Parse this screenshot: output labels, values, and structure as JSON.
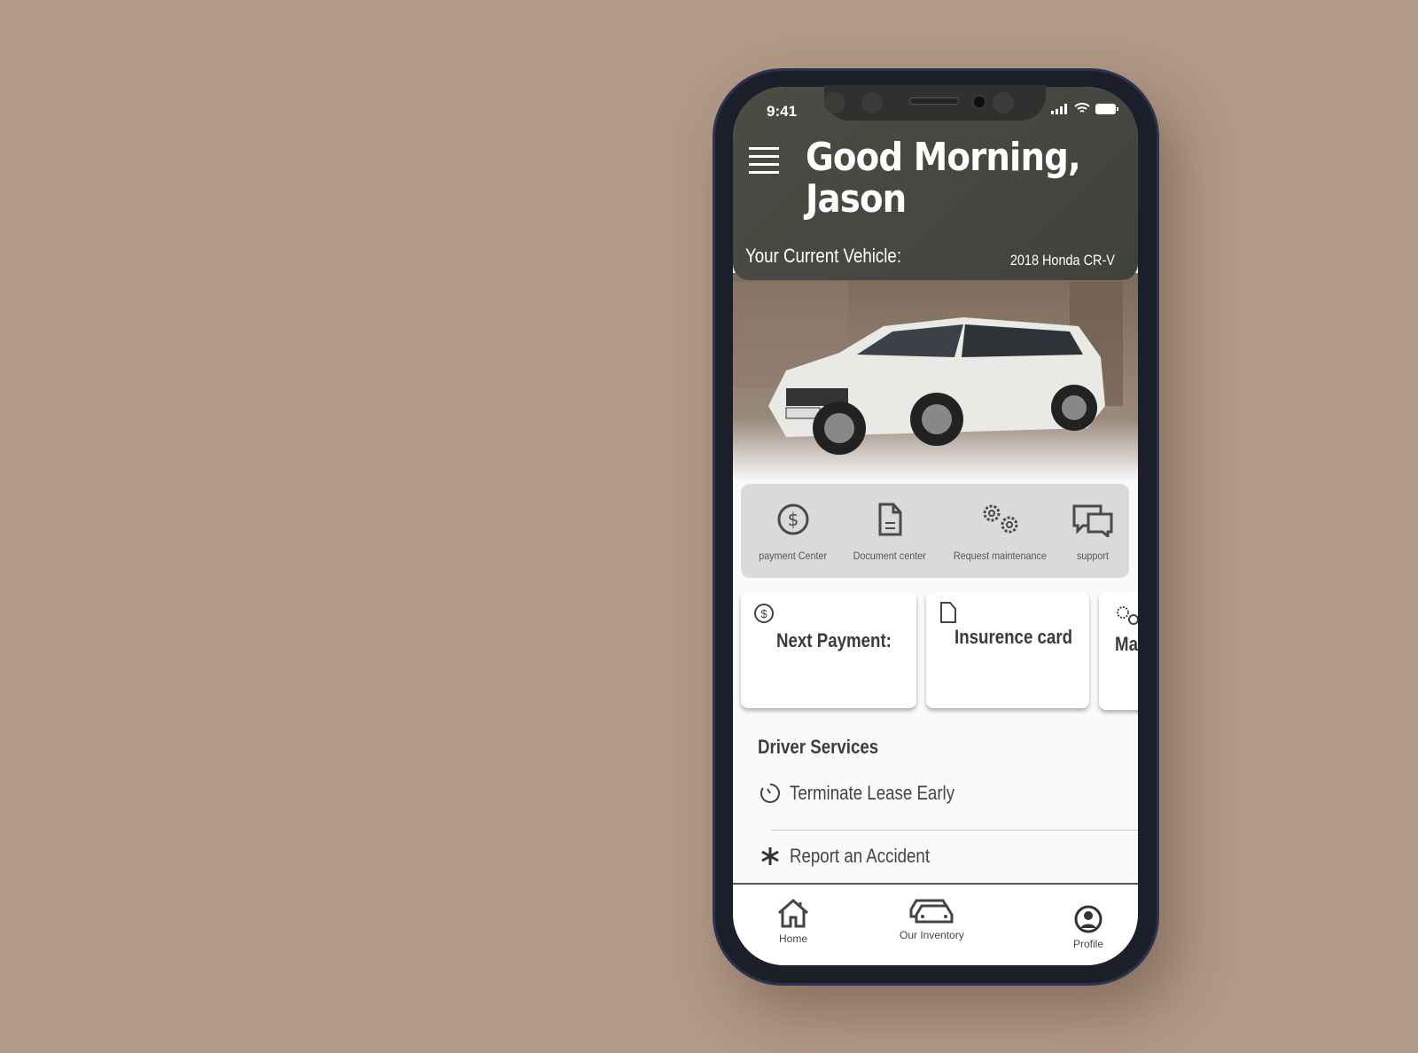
{
  "status_bar": {
    "time": "9:41"
  },
  "header": {
    "greeting_line1": "Good Morning,",
    "greeting_line2": "Jason",
    "current_vehicle_label": "Your Current Vehicle:",
    "current_vehicle_value": "2018 Honda CR-V"
  },
  "quick_actions": [
    {
      "label": "payment Center",
      "icon": "dollar-circle-icon"
    },
    {
      "label": "Document center",
      "icon": "document-icon"
    },
    {
      "label": "Request maintenance",
      "icon": "gears-icon"
    },
    {
      "label": "support",
      "icon": "chat-bubbles-icon"
    }
  ],
  "cards": [
    {
      "title": "Next Payment:",
      "icon": "dollar-circle-icon"
    },
    {
      "title": "Insurence card",
      "icon": "document-icon"
    },
    {
      "title": "Ma",
      "icon": "gears-icon"
    }
  ],
  "driver_services": {
    "title": "Driver Services",
    "items": [
      {
        "label": "Terminate Lease Early",
        "icon": "timer-icon"
      },
      {
        "label": "Report an Accident",
        "icon": "asterisk-icon"
      }
    ]
  },
  "bottom_nav": [
    {
      "label": "Home"
    },
    {
      "label": "Our Inventory"
    },
    {
      "label": "Profile"
    }
  ],
  "colors": {
    "background": "#b29886",
    "header": "#4b4d45",
    "panel": "#d9dadb"
  }
}
